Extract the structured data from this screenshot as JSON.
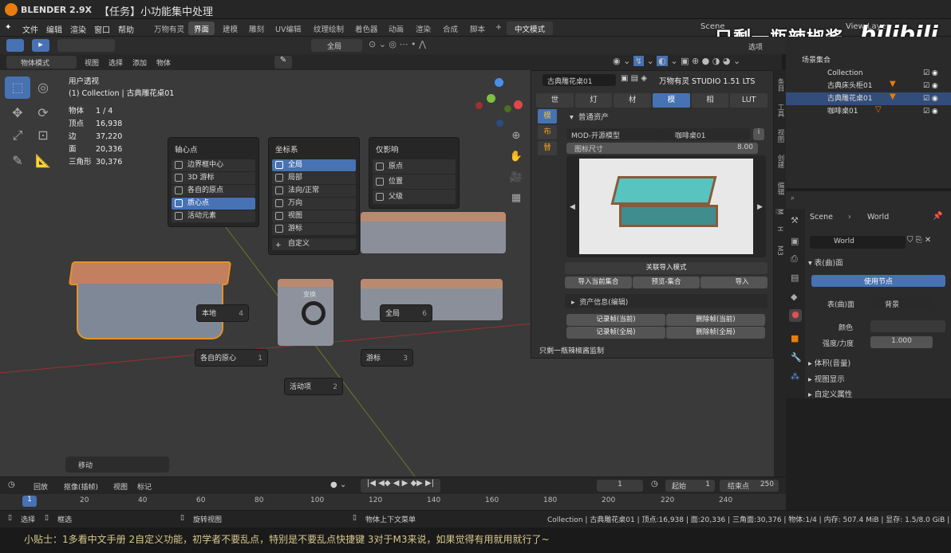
{
  "window": {
    "app": "BLENDER 2.9X",
    "project": "【任务】小功能集中处理"
  },
  "menu": [
    "文件",
    "编辑",
    "渲染",
    "窗口",
    "帮助"
  ],
  "workspaces": [
    "万物有灵",
    "界面",
    "建模",
    "雕刻",
    "UV编辑",
    "纹理绘制",
    "着色器",
    "动画",
    "渲染",
    "合成",
    "脚本"
  ],
  "workspace_active": "界面",
  "lang_button": "中文模式",
  "scene_label": "Scene",
  "view_layer_label": "View Layer",
  "watermark": "只剩一瓶辣椒酱",
  "bilibili": "bilibili",
  "options_label": "选项",
  "header2": {
    "mode": "物体模式",
    "view": "视图",
    "select": "选择",
    "add": "添加",
    "object": "物体",
    "transform": "全局"
  },
  "viewport": {
    "title": "用户透视",
    "subtitle": "(1) Collection | 古典雕花桌01",
    "stats": [
      [
        "物体",
        "1 / 4"
      ],
      [
        "顶点",
        "16,938"
      ],
      [
        "边",
        "37,220"
      ],
      [
        "面",
        "20,336"
      ],
      [
        "三角形",
        "30,376"
      ]
    ]
  },
  "popup_pivot": {
    "title": "轴心点",
    "items": [
      "边界框中心",
      "3D 游标",
      "各自的原点",
      "质心点",
      "活动元素"
    ],
    "active": 3
  },
  "popup_coord": {
    "title": "坐标系",
    "items": [
      "全局",
      "局部",
      "法向/正常",
      "万向",
      "视图",
      "游标"
    ],
    "add": "自定义",
    "active": 0
  },
  "popup_affect": {
    "title": "仅影响",
    "items": [
      "原点",
      "位置",
      "父级"
    ]
  },
  "pie": [
    [
      "本地",
      "4"
    ],
    [
      "全局",
      "6"
    ],
    [
      "各自的原心",
      "1"
    ],
    [
      "游标",
      "3"
    ],
    [
      "活动项",
      "2"
    ]
  ],
  "transform_label": "变换",
  "operator_panel": "移动",
  "asset_panel": {
    "object_name": "古典雕花桌01",
    "addon": "万物有灵 STUDIO 1.51 LTS",
    "tabs": [
      "世",
      "灯",
      "材",
      "模",
      "相",
      "LUT"
    ],
    "tab_active": 3,
    "side_tabs": [
      "模",
      "布",
      "替"
    ],
    "section": "普通资产",
    "category": "MOD-开源模型",
    "item": "咖啡桌01",
    "icon_size_label": "图标尺寸",
    "icon_size": "8.00",
    "link_mode": "关联导入模式",
    "import_collection": "导入当前集合",
    "preview_collection": "预览-集合",
    "import": "导入",
    "asset_info": "资产信息(编辑)",
    "rec_cur": "记录帧(当前)",
    "del_cur": "删除帧(当前)",
    "rec_all": "记录帧(全局)",
    "del_all": "删除帧(全局)",
    "footer": "只剩一瓶辣椒酱监制"
  },
  "right_tabs": [
    "条目",
    "工具",
    "视图",
    "创建",
    "编辑",
    "M",
    "H",
    "M3"
  ],
  "outliner": {
    "root": "场景集合",
    "rows": [
      "Collection",
      "古典床头柜01",
      "古典雕花桌01",
      "咖啡桌01"
    ]
  },
  "properties": {
    "scene": "Scene",
    "world": "World",
    "world_name": "World",
    "surface": "表(曲)面",
    "use_nodes": "使用节点",
    "surface_label": "表(曲)面",
    "surface_value": "背景",
    "color": "颜色",
    "strength": "强度/力度",
    "strength_value": "1.000",
    "volume": "体积(音量)",
    "viewport_display": "视图显示",
    "custom_props": "自定义属性"
  },
  "timeline": {
    "playback": "回放",
    "keying": "抠像(插帧)",
    "view": "视图",
    "marker": "标记",
    "current": "1",
    "start_label": "起始",
    "start": "1",
    "end_label": "结束点",
    "end": "250",
    "ticks": [
      "1",
      "20",
      "40",
      "60",
      "80",
      "100",
      "120",
      "140",
      "160",
      "180",
      "200",
      "220",
      "240"
    ]
  },
  "statusbar": {
    "select": "选择",
    "box": "框选",
    "rotate": "旋转视图",
    "context": "物体上下文菜单",
    "info": "Collection | 古典雕花桌01 | 顶点:16,938 | 面:20,336 | 三角面:30,376 | 物体:1/4 | 内存: 507.4 MiB | 显存: 1.5/8.0 GiB | 2.9"
  },
  "tip": "小贴士：1多看中文手册 2自定义功能，初学者不要乱点，特别是不要乱点快捷键 3对于M3来说，如果觉得有用就用就行了~",
  "colors": {
    "accent": "#4772b3",
    "orange": "#e87d0d"
  }
}
